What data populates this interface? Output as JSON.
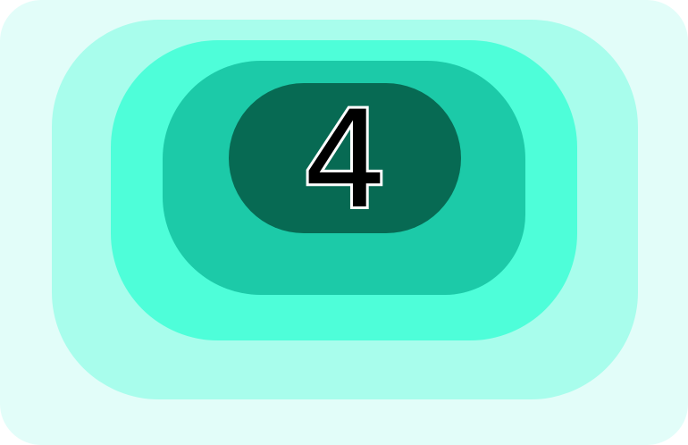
{
  "counter": {
    "value": "4"
  },
  "colors": {
    "layer_0": "#e2fdf9",
    "layer_1": "#a8fdec",
    "layer_2": "#4efed9",
    "layer_3": "#1ccaa8",
    "layer_4": "#076a53",
    "digit_fill": "#000000",
    "digit_outline": "#ffffff"
  }
}
